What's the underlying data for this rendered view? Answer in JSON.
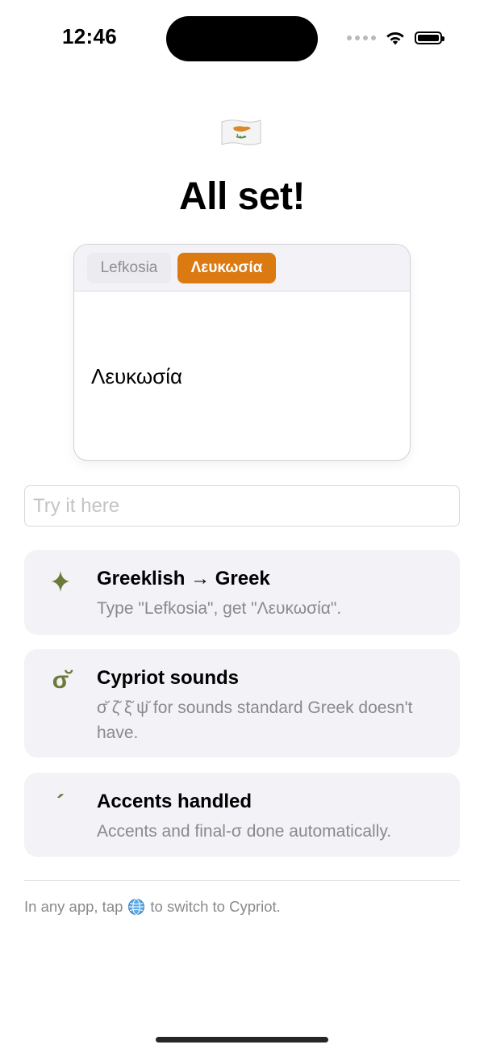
{
  "status_bar": {
    "time": "12:46",
    "icons": [
      "signal-icon",
      "wifi-icon",
      "battery-icon"
    ]
  },
  "header": {
    "flag_icon": "cyprus-flag-icon",
    "title": "All set!"
  },
  "preview": {
    "tabs": [
      {
        "label": "Lefkosia",
        "selected": false
      },
      {
        "label": "Λευκωσία",
        "selected": true
      }
    ],
    "text": "Λευκωσία"
  },
  "input": {
    "placeholder": "Try it here",
    "value": ""
  },
  "features": [
    {
      "icon": "sparkle-icon",
      "title": "Greeklish → Greek",
      "description": "Type \"Lefkosia\", get \"Λευκωσία\"."
    },
    {
      "icon": "cypriot-letter-icon",
      "icon_glyph": "σ̆",
      "title": "Cypriot sounds",
      "description": "σ̆ ζ̆ ξ̆ ψ̆ for sounds standard Greek doesn't have."
    },
    {
      "icon": "accent-icon",
      "icon_glyph": "´",
      "title": "Accents handled",
      "description": "Accents and final-σ done automatically."
    }
  ],
  "footer": {
    "prefix": "In any app, tap",
    "globe_icon": "globe-icon",
    "suffix": "to switch to Cypriot."
  },
  "colors": {
    "accent": "#dc7a12",
    "icon_green": "#6b7a38",
    "card_background": "#f2f2f7",
    "secondary_text": "#8a8a8e"
  }
}
